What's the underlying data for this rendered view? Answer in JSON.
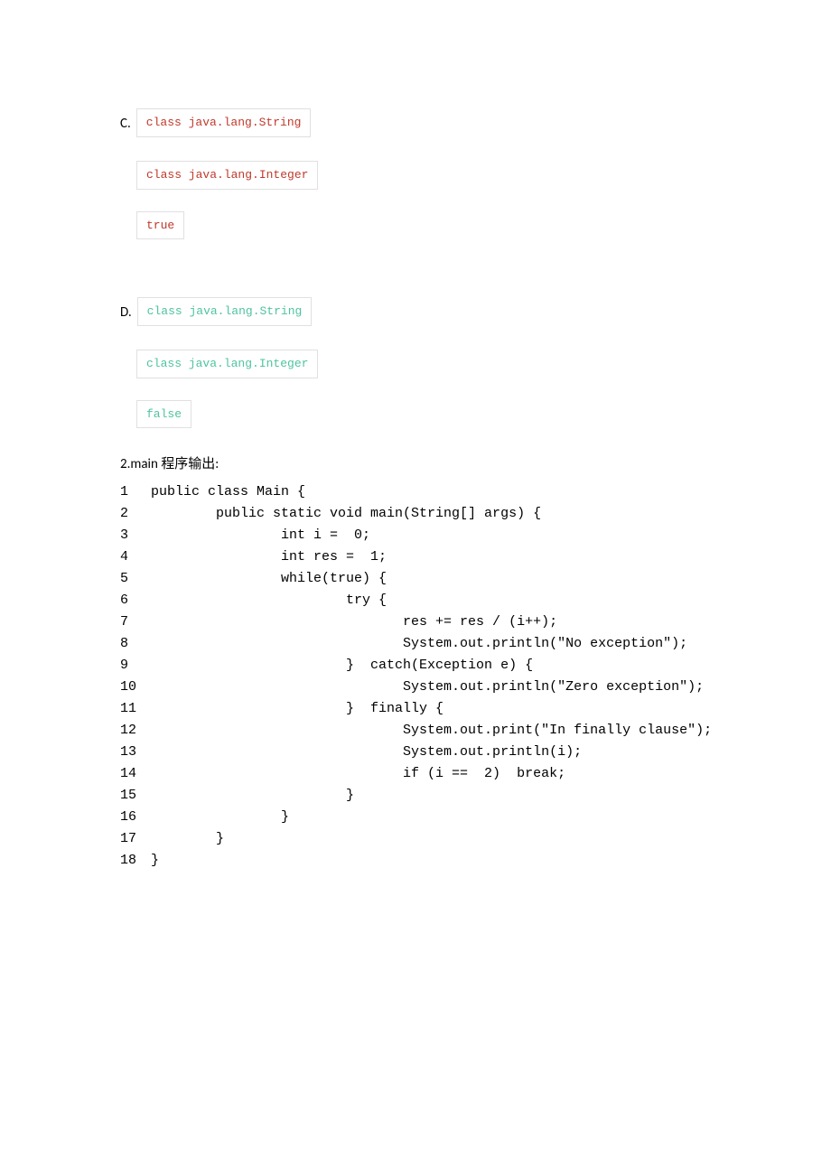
{
  "optionC": {
    "label": "C.",
    "box1": "class java.lang.String",
    "box2": "class java.lang.Integer",
    "box3": "true"
  },
  "optionD": {
    "label": "D.",
    "box1": "class java.lang.String",
    "box2": "class java.lang.Integer",
    "box3": "false"
  },
  "section2": {
    "title": "2.main 程序输出:",
    "lines": [
      {
        "n": "1",
        "c": "public class Main {"
      },
      {
        "n": "2",
        "c": "        public static void main(String[] args) {"
      },
      {
        "n": "3",
        "c": "                int i =  0;"
      },
      {
        "n": "4",
        "c": "                int res =  1;"
      },
      {
        "n": "5",
        "c": "                while(true) {"
      },
      {
        "n": "6",
        "c": "                        try {"
      },
      {
        "n": "7",
        "c": "                               res += res / (i++);"
      },
      {
        "n": "8",
        "c": "                               System.out.println(\"No exception\");"
      },
      {
        "n": "9",
        "c": "                        }  catch(Exception e) {"
      },
      {
        "n": "10",
        "c": "                               System.out.println(\"Zero exception\");"
      },
      {
        "n": "11",
        "c": "                        }  finally {"
      },
      {
        "n": "12",
        "c": "                               System.out.print(\"In finally clause\");"
      },
      {
        "n": "13",
        "c": "                               System.out.println(i);"
      },
      {
        "n": "14",
        "c": "                               if (i ==  2)  break;"
      },
      {
        "n": "15",
        "c": "                        }"
      },
      {
        "n": "16",
        "c": "                }"
      },
      {
        "n": "17",
        "c": "        }"
      },
      {
        "n": "18",
        "c": "}"
      }
    ]
  }
}
